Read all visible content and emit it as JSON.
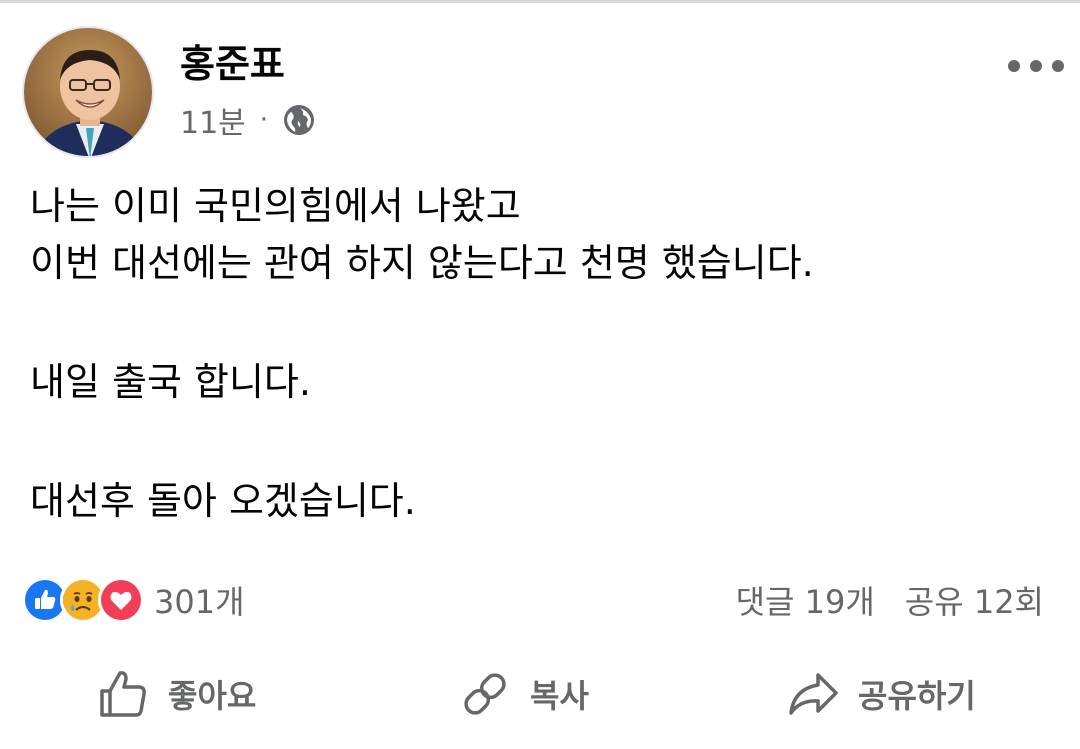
{
  "post": {
    "author": "홍준표",
    "time": "11분",
    "separator": "·",
    "privacy_icon": "globe-icon",
    "lines": [
      "나는 이미 국민의힘에서 나왔고",
      "이번 대선에는 관여 하지 않는다고 천명 했습니다.",
      "",
      "내일 출국 합니다.",
      "",
      "대선후 돌아 오겠습니다."
    ]
  },
  "reactions": {
    "icons": [
      "like-icon",
      "sad-icon",
      "love-icon"
    ],
    "count": "301개",
    "comments": "댓글 19개",
    "shares": "공유 12회"
  },
  "actions": {
    "like_label": "좋아요",
    "copy_label": "복사",
    "share_label": "공유하기"
  },
  "colors": {
    "like_blue": "#1877f2",
    "love_red": "#f33e58",
    "sad_yellow": "#f7b125",
    "secondary_text": "#65676b"
  }
}
